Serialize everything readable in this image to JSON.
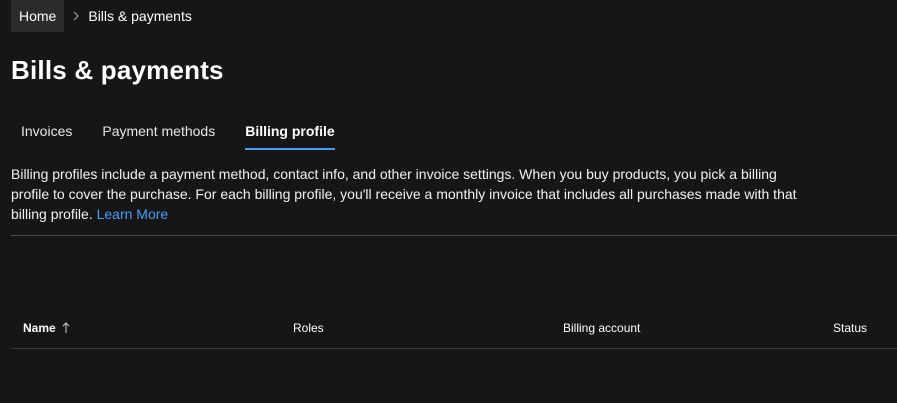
{
  "breadcrumb": {
    "home": "Home",
    "current": "Bills & payments"
  },
  "page": {
    "title": "Bills & payments"
  },
  "tabs": [
    {
      "label": "Invoices",
      "active": false
    },
    {
      "label": "Payment methods",
      "active": false
    },
    {
      "label": "Billing profile",
      "active": true
    }
  ],
  "description": {
    "text": "Billing profiles include a payment method, contact info, and other invoice settings. When you buy products, you pick a billing profile to cover the purchase. For each billing profile, you'll receive a monthly invoice that includes all purchases made with that billing profile.",
    "link_label": "Learn More"
  },
  "table": {
    "columns": [
      {
        "label": "Name",
        "sorted": "ascending"
      },
      {
        "label": "Roles"
      },
      {
        "label": "Billing account"
      },
      {
        "label": "Status"
      }
    ]
  },
  "colors": {
    "background": "#161616",
    "accent": "#479ef5"
  },
  "icons": {
    "breadcrumb_separator": "chevron-right-icon",
    "sort": "arrow-up-icon"
  }
}
